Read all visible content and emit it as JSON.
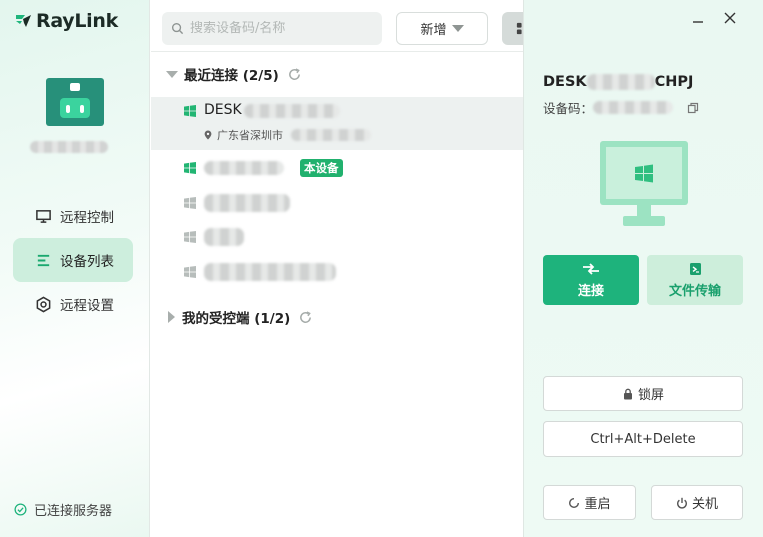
{
  "app": {
    "name": "RayLink"
  },
  "sidebar": {
    "nav": [
      {
        "label": "远程控制",
        "icon": "monitor-icon"
      },
      {
        "label": "设备列表",
        "icon": "list-icon"
      },
      {
        "label": "远程设置",
        "icon": "settings-icon"
      }
    ],
    "status": "已连接服务器"
  },
  "toolbar": {
    "search_placeholder": "搜索设备码/名称",
    "add_label": "新增"
  },
  "groups": {
    "recent": {
      "label": "最近连接 (2/5)"
    },
    "mine": {
      "label": "我的受控端 (1/2)"
    }
  },
  "devices": {
    "selected": {
      "name": "DESK",
      "location": "广东省深圳市"
    },
    "current_badge": "本设备"
  },
  "panel": {
    "name_prefix": "DESK",
    "name_suffix": "CHPJ",
    "code_label": "设备码：",
    "connect_label": "连接",
    "file_label": "文件传输",
    "lock_label": "锁屏",
    "cad_label": "Ctrl+Alt+Delete",
    "restart_label": "重启",
    "shutdown_label": "关机"
  },
  "colors": {
    "accent": "#1eb37c",
    "accent_light": "#cdeedb",
    "nav_active": "#cdeedd"
  }
}
